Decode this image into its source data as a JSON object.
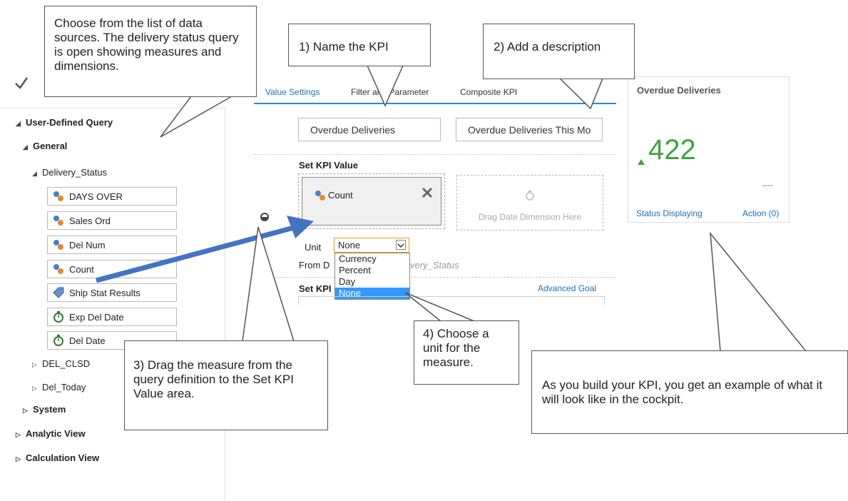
{
  "left_panel": {
    "check_icon": "checkmark-icon",
    "tree": {
      "user_defined_query": "User-Defined Query",
      "general": "General",
      "delivery_status": "Delivery_Status",
      "fields": [
        "DAYS OVER",
        "Sales Ord",
        "Del Num",
        "Count",
        "Ship Stat Results",
        "Exp Del Date",
        "Del Date"
      ],
      "del_clsd": "DEL_CLSD",
      "del_today": "Del_Today",
      "system": "System",
      "analytic_view": "Analytic View",
      "calculation_view": "Calculation View"
    }
  },
  "tabs": [
    "Value Settings",
    "Filter and Parameter",
    "Composite KPI"
  ],
  "kpi_name_value": "Overdue Deliveries",
  "kpi_description_value": "Overdue Deliveries This Mo",
  "set_kpi_value": {
    "title": "Set KPI Value",
    "measure_chip": "Count",
    "date_drop_hint": "Drag Date Dimension Here",
    "unit_label": "Unit",
    "unit_selected": "None",
    "unit_options": [
      "Currency",
      "Percent",
      "Day",
      "None"
    ],
    "from_label": "From D",
    "from_value": "very_Status"
  },
  "set_kpi_goal_label": "Set KPI",
  "advanced_goal_link": "Advanced Goal",
  "preview_tile": {
    "title": "Overdue Deliveries",
    "value": "422",
    "trend": "up",
    "dashes": "----",
    "status": "Status Displaying",
    "action": "Action (0)",
    "value_color": "#3aa53a"
  },
  "callouts": {
    "choose": "Choose from the list of data sources. The delivery status query is open showing measures and dimensions.",
    "name": "1) Name the KPI",
    "description": "2) Add a description",
    "drag": "3) Drag the measure from the query  definition to the Set KPI Value area.",
    "unit": "4) Choose a unit for the measure.",
    "preview": "As you build  your KPI, you get an example of what it will look like in the cockpit."
  }
}
